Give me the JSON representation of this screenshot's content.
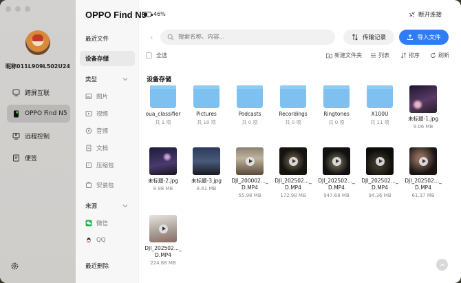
{
  "app": {
    "device_title": "OPPO Find N5",
    "battery_pct": "46%",
    "disconnect_label": "断开连接"
  },
  "left_sidebar": {
    "nickname": "昵称011L909L502U24",
    "items": [
      {
        "label": "跨屏互联",
        "icon": "screen-cast-icon"
      },
      {
        "label": "OPPO Find N5",
        "icon": "phone-icon"
      },
      {
        "label": "远程控制",
        "icon": "remote-control-icon"
      },
      {
        "label": "便签",
        "icon": "note-icon"
      }
    ]
  },
  "middle_nav": {
    "recent_files": "最近文件",
    "device_storage": "设备存储",
    "type_header": "类型",
    "types": [
      "图片",
      "视频",
      "音频",
      "文档",
      "压缩包",
      "安装包"
    ],
    "source_header": "来源",
    "sources": [
      "微信",
      "QQ"
    ],
    "recently_deleted": "最近删除"
  },
  "toolbar": {
    "search_placeholder": "搜索名称、内容...",
    "transfer_label": "传输记录",
    "import_label": "导入文件",
    "select_all": "全选",
    "new_folder": "新建文件夹",
    "list_view": "列表",
    "sort": "排序",
    "refresh": "刷新"
  },
  "content": {
    "section_title": "设备存储",
    "items": [
      {
        "kind": "folder",
        "name": "oua_classifier",
        "meta": "共 1 项"
      },
      {
        "kind": "folder",
        "name": "Pictures",
        "meta": "共 10 项"
      },
      {
        "kind": "folder",
        "name": "Podcasts",
        "meta": "共 0 项"
      },
      {
        "kind": "folder",
        "name": "Recordings",
        "meta": "共 0 项"
      },
      {
        "kind": "folder",
        "name": "Ringtones",
        "meta": "共 0 项"
      },
      {
        "kind": "folder",
        "name": "X100U",
        "meta": "共 11 项"
      },
      {
        "kind": "image",
        "name": "未标题-1.jpg",
        "meta": "9.06 MB"
      },
      {
        "kind": "image",
        "name": "未标题-2.jpg",
        "meta": "8.98 MB"
      },
      {
        "kind": "image",
        "name": "未标题-3.jpg",
        "meta": "8.61 MB"
      },
      {
        "kind": "video",
        "name": "DJI_200002..._D.MP4",
        "name1": "DJI_200002..._",
        "name2": "D.MP4",
        "meta": "55.98 MB"
      },
      {
        "kind": "video",
        "name": "DJI_202502..._D.MP4",
        "name1": "DJI_202502..._",
        "name2": "D.MP4",
        "meta": "172.98 MB"
      },
      {
        "kind": "video",
        "name": "DJI_202502..._D.MP4",
        "name1": "DJI_202502..._",
        "name2": "D.MP4",
        "meta": "947.68 MB"
      },
      {
        "kind": "video",
        "name": "DJI_202502..._D.MP4",
        "name1": "DJI_202502..._",
        "name2": "D.MP4",
        "meta": "94.36 MB"
      },
      {
        "kind": "video",
        "name": "DJI_202502..._D.MP4",
        "name1": "DJI_202502..._",
        "name2": "D.MP4",
        "meta": "61.37 MB"
      },
      {
        "kind": "video",
        "name": "DJI_202502..._D.MP4",
        "name1": "DJI_202502..._",
        "name2": "D.MP4",
        "meta": "224.88 MB"
      }
    ]
  },
  "colors": {
    "accent": "#2f7cf6",
    "folder": "#7ec0f0",
    "sidebar_bg": "#d0cfcc",
    "wechat": "#22b14c",
    "qq": "#d9302a"
  }
}
